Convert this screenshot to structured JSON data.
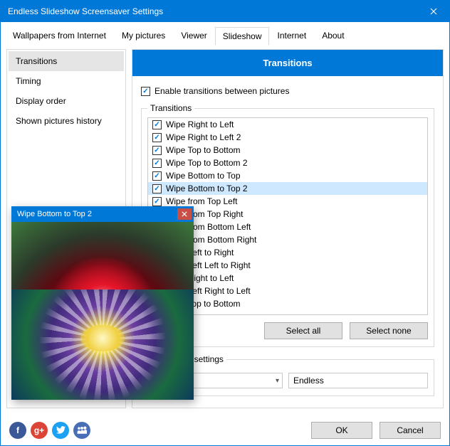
{
  "window": {
    "title": "Endless Slideshow Screensaver Settings"
  },
  "tabs": {
    "items": [
      {
        "label": "Wallpapers from Internet"
      },
      {
        "label": "My pictures"
      },
      {
        "label": "Viewer"
      },
      {
        "label": "Slideshow"
      },
      {
        "label": "Internet"
      },
      {
        "label": "About"
      }
    ],
    "active_index": 3
  },
  "sidebar": {
    "items": [
      {
        "label": "Transitions"
      },
      {
        "label": "Timing"
      },
      {
        "label": "Display order"
      },
      {
        "label": "Shown pictures history"
      }
    ],
    "active_index": 0
  },
  "main": {
    "header": "Transitions",
    "enable_label": "Enable transitions between pictures",
    "enable_checked": true,
    "group_label": "Transitions",
    "transitions": [
      {
        "label": "Wipe Right to Left",
        "checked": true
      },
      {
        "label": "Wipe Right to Left 2",
        "checked": true
      },
      {
        "label": "Wipe Top to Bottom",
        "checked": true
      },
      {
        "label": "Wipe Top to Bottom 2",
        "checked": true
      },
      {
        "label": "Wipe Bottom to Top",
        "checked": true
      },
      {
        "label": "Wipe Bottom to Top 2",
        "checked": true
      },
      {
        "label": "Wipe from Top Left",
        "checked": true
      },
      {
        "label": "Wipe from Top Right",
        "checked": true
      },
      {
        "label": "Wipe from Bottom Left",
        "checked": true
      },
      {
        "label": "Wipe from Bottom Right",
        "checked": true
      },
      {
        "label": "Wipe Left to Right",
        "checked": true
      },
      {
        "label": "Wipe Left Left to Right",
        "checked": true
      },
      {
        "label": "Wipe Right to Left",
        "checked": true
      },
      {
        "label": "Wipe Left Right to Left",
        "checked": true
      },
      {
        "label": "Wipe Top to Bottom",
        "checked": true
      }
    ],
    "selected_transition_index": 5,
    "select_all_label": "Select all",
    "select_none_label": "Select none",
    "settings_legend": "Transitions settings",
    "speed_combo": "",
    "preset_value": "Endless"
  },
  "preview": {
    "title": "Wipe Bottom to Top 2"
  },
  "footer": {
    "ok": "OK",
    "cancel": "Cancel"
  }
}
